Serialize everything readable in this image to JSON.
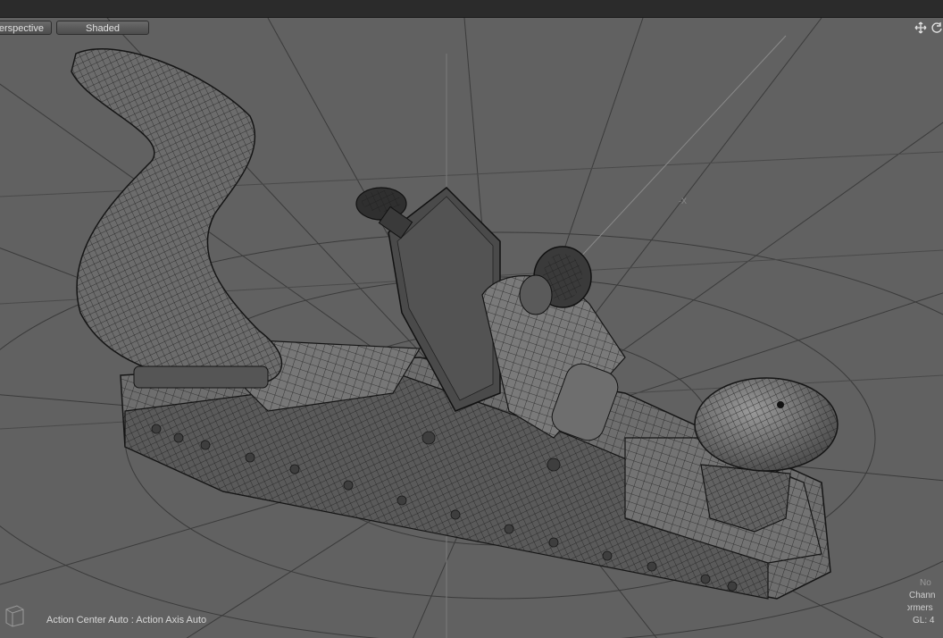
{
  "viewport": {
    "projection_label": "erspective",
    "shading_label": "Shaded",
    "axis_marker": "-X",
    "status_text": "Action Center Auto : Action Axis Auto",
    "info_lines": [
      "No",
      "Chann",
      "Deformers",
      "GL: 4"
    ]
  },
  "icons": {
    "move_view": "move-view-icon",
    "rotate_view": "rotate-view-icon",
    "cube": "view-cube-icon"
  },
  "colors": {
    "background": "#616161",
    "grid": "#3a3a3a",
    "model_fill": "#707070",
    "wire": "#1c1c1c"
  }
}
